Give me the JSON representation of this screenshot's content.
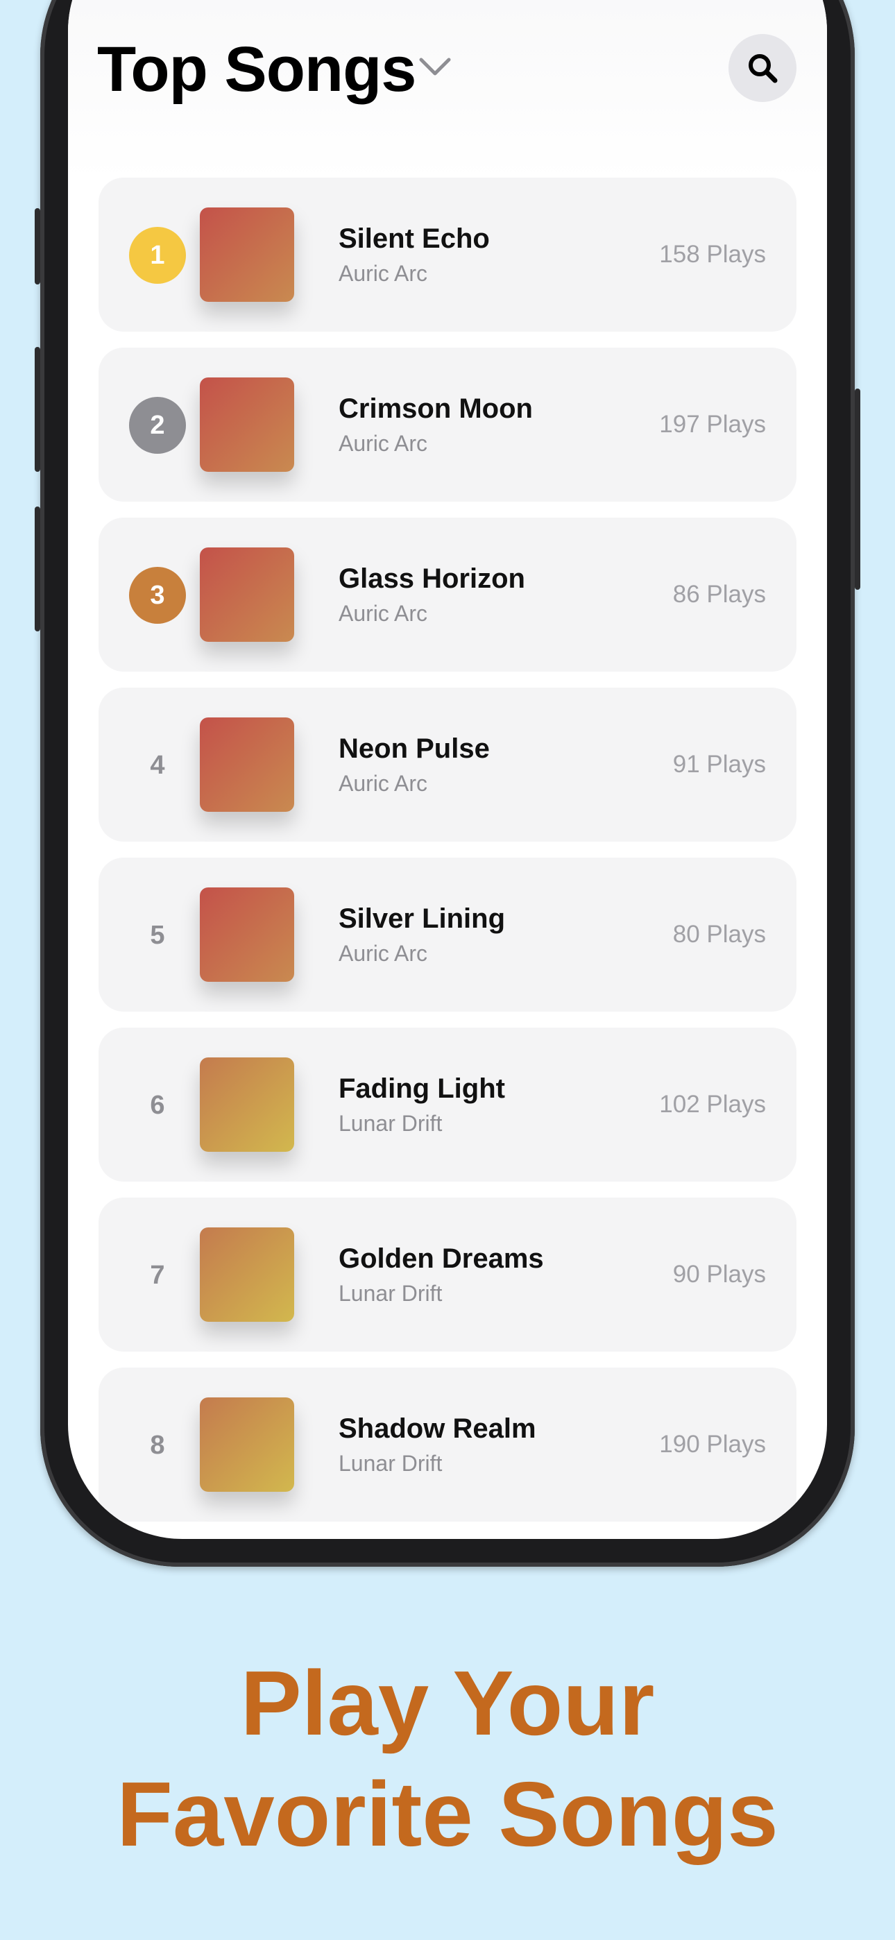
{
  "header": {
    "title": "Top Songs",
    "search_icon": "search-icon",
    "chevron_icon": "chevron-down-icon"
  },
  "songs": [
    {
      "rank": "1",
      "title": "Silent Echo",
      "artist": "Auric Arc",
      "plays": "158 Plays",
      "medal": "gold"
    },
    {
      "rank": "2",
      "title": "Crimson Moon",
      "artist": "Auric Arc",
      "plays": "197 Plays",
      "medal": "silver"
    },
    {
      "rank": "3",
      "title": "Glass Horizon",
      "artist": "Auric Arc",
      "plays": "86 Plays",
      "medal": "bronze"
    },
    {
      "rank": "4",
      "title": "Neon Pulse",
      "artist": "Auric Arc",
      "plays": "91 Plays",
      "medal": ""
    },
    {
      "rank": "5",
      "title": "Silver Lining",
      "artist": "Auric Arc",
      "plays": "80 Plays",
      "medal": ""
    },
    {
      "rank": "6",
      "title": "Fading Light",
      "artist": "Lunar Drift",
      "plays": "102 Plays",
      "medal": ""
    },
    {
      "rank": "7",
      "title": "Golden Dreams",
      "artist": "Lunar Drift",
      "plays": "90 Plays",
      "medal": ""
    },
    {
      "rank": "8",
      "title": "Shadow Realm",
      "artist": "Lunar Drift",
      "plays": "190 Plays",
      "medal": ""
    }
  ],
  "artwork_colors": {
    "Auric Arc": [
      "#c4524a",
      "#c98a50"
    ],
    "Lunar Drift": [
      "#c47b4e",
      "#d2b84e"
    ]
  },
  "promo": {
    "line1": "Play Your",
    "line2": "Favorite Songs"
  },
  "colors": {
    "background": "#d4eefb",
    "headline": "#c4691e",
    "gold": "#f5c842",
    "silver": "#8e8e93",
    "bronze": "#c8803c"
  }
}
